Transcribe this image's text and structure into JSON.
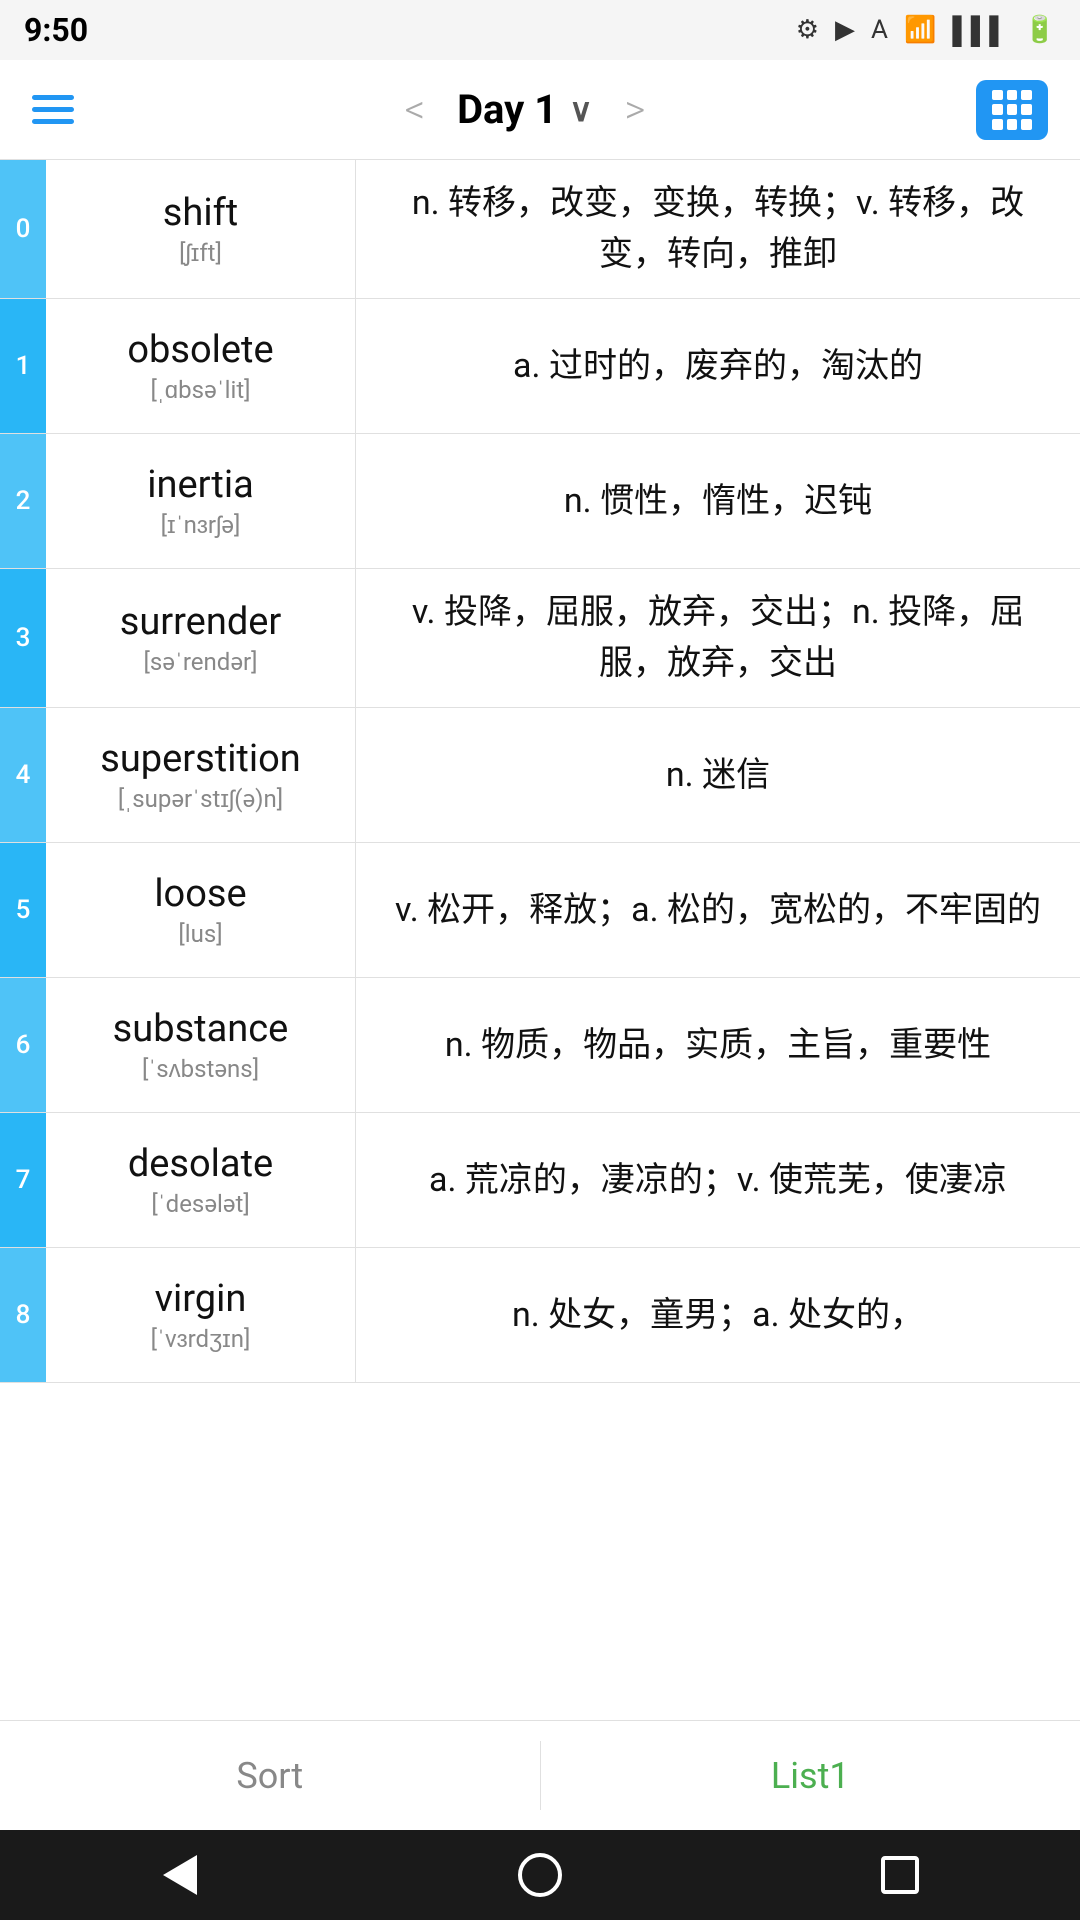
{
  "statusBar": {
    "time": "9:50",
    "icons": [
      "⚙",
      "▶",
      "A",
      "?",
      "•"
    ]
  },
  "navBar": {
    "title": "Day 1",
    "gridIcon": "grid-icon",
    "prevArrow": "<",
    "nextArrow": ">"
  },
  "words": [
    {
      "index": "0",
      "word": "shift",
      "phonetic": "[ʃɪft]",
      "definition": "n. 转移，改变，变换，转换；v. 转移，改变，转向，推卸"
    },
    {
      "index": "1",
      "word": "obsolete",
      "phonetic": "[ˌɑbsəˈlit]",
      "definition": "a. 过时的，废弃的，淘汰的"
    },
    {
      "index": "2",
      "word": "inertia",
      "phonetic": "[ɪˈnɜrʃə]",
      "definition": "n. 惯性，惰性，迟钝"
    },
    {
      "index": "3",
      "word": "surrender",
      "phonetic": "[səˈrendər]",
      "definition": "v. 投降，屈服，放弃，交出；n. 投降，屈服，放弃，交出"
    },
    {
      "index": "4",
      "word": "superstition",
      "phonetic": "[ˌsupərˈstɪʃ(ə)n]",
      "definition": "n. 迷信"
    },
    {
      "index": "5",
      "word": "loose",
      "phonetic": "[lus]",
      "definition": "v. 松开，释放；a. 松的，宽松的，不牢固的"
    },
    {
      "index": "6",
      "word": "substance",
      "phonetic": "[ˈsʌbstəns]",
      "definition": "n. 物质，物品，实质，主旨，重要性"
    },
    {
      "index": "7",
      "word": "desolate",
      "phonetic": "[ˈdesələt]",
      "definition": "a. 荒凉的，凄凉的；v. 使荒芜，使凄凉"
    },
    {
      "index": "8",
      "word": "virgin",
      "phonetic": "[ˈvɜrdʒɪn]",
      "definition": "n. 处女，童男；a. 处女的，"
    }
  ],
  "tabs": [
    {
      "label": "Sort",
      "active": false
    },
    {
      "label": "List1",
      "active": true
    }
  ],
  "androidNav": {
    "back": "back",
    "home": "home",
    "recents": "recents"
  }
}
